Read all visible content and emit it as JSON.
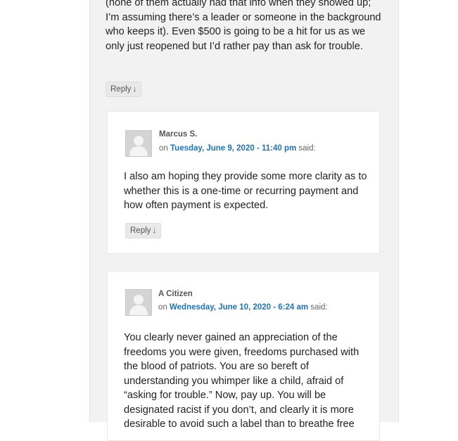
{
  "top_comment": {
    "text": "(none of them actually had that info when they showed up; I’m assuming there’s a leader or someone in the background who keeps it). Even $500 is going to be a hit for us as we only just reopened but I’d rather pay than ask for trouble.",
    "reply_label": "Reply",
    "reply_arrow": "↓"
  },
  "comments": [
    {
      "author": "Marcus S.",
      "on_label": "on",
      "date": "Tuesday, June 9, 2020 - 11:40 pm",
      "said_label": "said:",
      "text": "I also am hoping they provide some more clarity as to whether this is a one-time or recurring payment and how often payment is expected.",
      "reply_label": "Reply",
      "reply_arrow": "↓"
    },
    {
      "author": "A Citizen",
      "on_label": "on",
      "date": "Wednesday, June 10, 2020 - 6:24 am",
      "said_label": "said:",
      "text": "You clearly never gained an appreciation of the freedoms you were given, freedoms purchased with the blood of patriots. You are so bereft of understanding you whimper like a child, afraid of “asking for trouble.” Now, pay up. You will be designated racist if you don’t, and clearly it is more desirable to avoid such a label than to breathe free"
    }
  ]
}
